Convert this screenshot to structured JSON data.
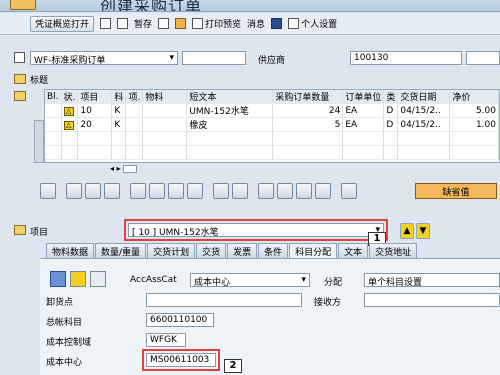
{
  "titlebar": {
    "title": "创建采购订单"
  },
  "toolbar": {
    "open_button": "凭证概览打开",
    "hold": "暂存",
    "print_preview": "打印预览",
    "messages": "消息",
    "personal_settings": "个人设置"
  },
  "header": {
    "doc_type": "WF-标准采购订单",
    "vendor_label": "供应商",
    "vendor_value": "100130"
  },
  "sections": {
    "header_label": "标题",
    "item_label": "项目"
  },
  "grid": {
    "columns": [
      "Bl.",
      "状.",
      "项目",
      "科",
      "项.",
      "物料",
      "短文本",
      "采购订单数量",
      "订单单位",
      "类",
      "交货日期",
      "净价"
    ],
    "rows": [
      {
        "status": "△",
        "item": "10",
        "acct": "K",
        "item_cat": "",
        "material": "",
        "short_text": "UMN-152水笔",
        "qty": "24",
        "unit": "EA",
        "cat": "D",
        "date": "04/15/2..",
        "price": "5.00"
      },
      {
        "status": "△",
        "item": "20",
        "acct": "K",
        "item_cat": "",
        "material": "",
        "short_text": "橡皮",
        "qty": "5",
        "unit": "EA",
        "cat": "D",
        "date": "04/15/2..",
        "price": "1.00"
      }
    ]
  },
  "default_button": "缺省值",
  "item_select": {
    "value": "[ 10 ] UMN-152水笔"
  },
  "tabs": [
    "物料数据",
    "数量/重量",
    "交货计划",
    "交货",
    "发票",
    "条件",
    "科目分配",
    "文本",
    "交货地址"
  ],
  "panel": {
    "acc_ass_cat_label": "AccAssCat",
    "acc_ass_cat_value": "成本中心",
    "distribution_label": "分配",
    "single_account": "单个科目设置",
    "unloading_point_label": "卸货点",
    "recipient_label": "接收方",
    "gl_account_label": "总帐科目",
    "gl_account_value": "6600110100",
    "co_area_label": "成本控制域",
    "co_area_value": "WFGK",
    "cost_center_label": "成本中心",
    "cost_center_value": "MS00611003"
  },
  "callouts": {
    "one": "1",
    "two": "2"
  }
}
